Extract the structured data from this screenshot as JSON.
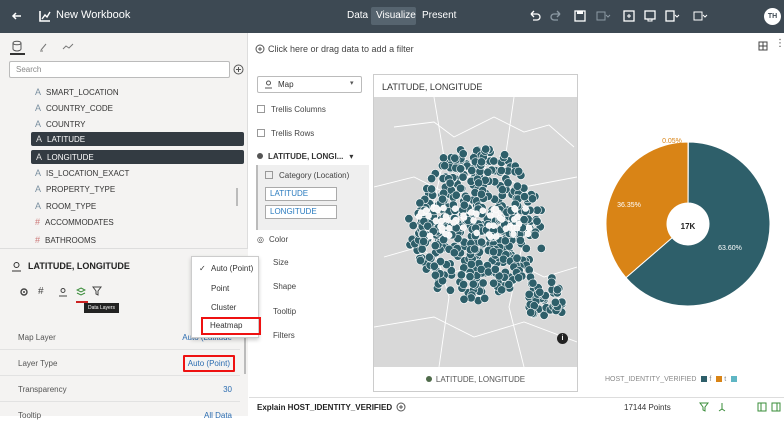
{
  "app": {
    "title": "New Workbook",
    "nav_tabs": [
      "Data",
      "Visualize",
      "Present"
    ],
    "avatar": "TH"
  },
  "data_panel": {
    "search_placeholder": "Search",
    "fields": [
      {
        "name": "SMART_LOCATION",
        "type": "A",
        "selected": false
      },
      {
        "name": "COUNTRY_CODE",
        "type": "A",
        "selected": false
      },
      {
        "name": "COUNTRY",
        "type": "A",
        "selected": false
      },
      {
        "name": "LATITUDE",
        "type": "A",
        "selected": true
      },
      {
        "name": "LONGITUDE",
        "type": "A",
        "selected": true
      },
      {
        "name": "IS_LOCATION_EXACT",
        "type": "A",
        "selected": false
      },
      {
        "name": "PROPERTY_TYPE",
        "type": "A",
        "selected": false
      },
      {
        "name": "ROOM_TYPE",
        "type": "A",
        "selected": false
      },
      {
        "name": "ACCOMMODATES",
        "type": "#",
        "selected": false
      },
      {
        "name": "BATHROOMS",
        "type": "#",
        "selected": false
      }
    ]
  },
  "properties": {
    "title": "LATITUDE, LONGITUDE",
    "tooltip": "Data Layers",
    "rows": [
      {
        "key": "Map Layer",
        "value": "Auto (Latitude"
      },
      {
        "key": "Layer Type",
        "value": "Auto (Point)"
      },
      {
        "key": "Transparency",
        "value": "30"
      },
      {
        "key": "Tooltip",
        "value": "All Data"
      }
    ]
  },
  "layer_menu": {
    "items": [
      "Auto (Point)",
      "Point",
      "Cluster",
      "Heatmap"
    ],
    "checked": "Auto (Point)",
    "highlighted": "Heatmap"
  },
  "filter_bar": {
    "placeholder": "Click here or drag data to add a filter"
  },
  "grammar": {
    "viz_type": "Map",
    "trellis_columns": "Trellis Columns",
    "trellis_rows": "Trellis Rows",
    "layer_name": "LATITUDE, LONGI...",
    "category_label": "Category (Location)",
    "pills": [
      "LATITUDE",
      "LONGITUDE"
    ],
    "channels": [
      "Color",
      "Size",
      "Shape",
      "Tooltip",
      "Filters"
    ]
  },
  "map_viz": {
    "title": "LATITUDE, LONGITUDE",
    "legend": "LATITUDE, LONGITUDE",
    "info": "i",
    "point_color": "#2e5f6a"
  },
  "chart_data": {
    "type": "pie",
    "donut": true,
    "center_label": "17K",
    "slices": [
      {
        "name": "f",
        "label": "63.60%",
        "value": 63.6,
        "color": "#2e5f6a"
      },
      {
        "name": "t",
        "label": "36.35%",
        "value": 36.35,
        "color": "#d98416"
      },
      {
        "name": "",
        "label": "0.05%",
        "value": 0.05,
        "color": "#5fb6c4"
      }
    ],
    "legend_title": "HOST_IDENTITY_VERIFIED",
    "legend": [
      {
        "label": "f",
        "color": "#2e5f6a"
      },
      {
        "label": "t",
        "color": "#d98416"
      },
      {
        "label": "",
        "color": "#5fb6c4"
      }
    ]
  },
  "bottom_bar": {
    "explain": "Explain HOST_IDENTITY_VERIFIED",
    "points": "17144 Points"
  }
}
